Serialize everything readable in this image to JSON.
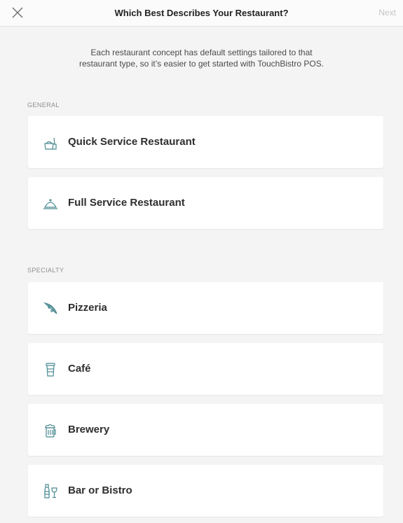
{
  "header": {
    "title": "Which Best Describes Your Restaurant?",
    "next_label": "Next",
    "close_icon": "close-icon"
  },
  "intro": {
    "line1": "Each restaurant concept has default settings tailored to that",
    "line2": "restaurant type, so it’s easier to get started with TouchBistro POS."
  },
  "sections": {
    "general": {
      "label": "GENERAL",
      "items": [
        {
          "label": "Quick Service Restaurant",
          "icon": "takeout-bag-icon"
        },
        {
          "label": "Full Service Restaurant",
          "icon": "cloche-icon"
        }
      ]
    },
    "specialty": {
      "label": "SPECIALTY",
      "items": [
        {
          "label": "Pizzeria",
          "icon": "pizza-slice-icon"
        },
        {
          "label": "Café",
          "icon": "coffee-cup-icon"
        },
        {
          "label": "Brewery",
          "icon": "beer-mug-icon"
        },
        {
          "label": "Bar or Bistro",
          "icon": "bottle-glass-icon"
        }
      ]
    }
  },
  "colors": {
    "background": "#f4f4f4",
    "card": "#ffffff",
    "icon": "#4b8a90",
    "next_disabled": "#c4c4c4"
  }
}
